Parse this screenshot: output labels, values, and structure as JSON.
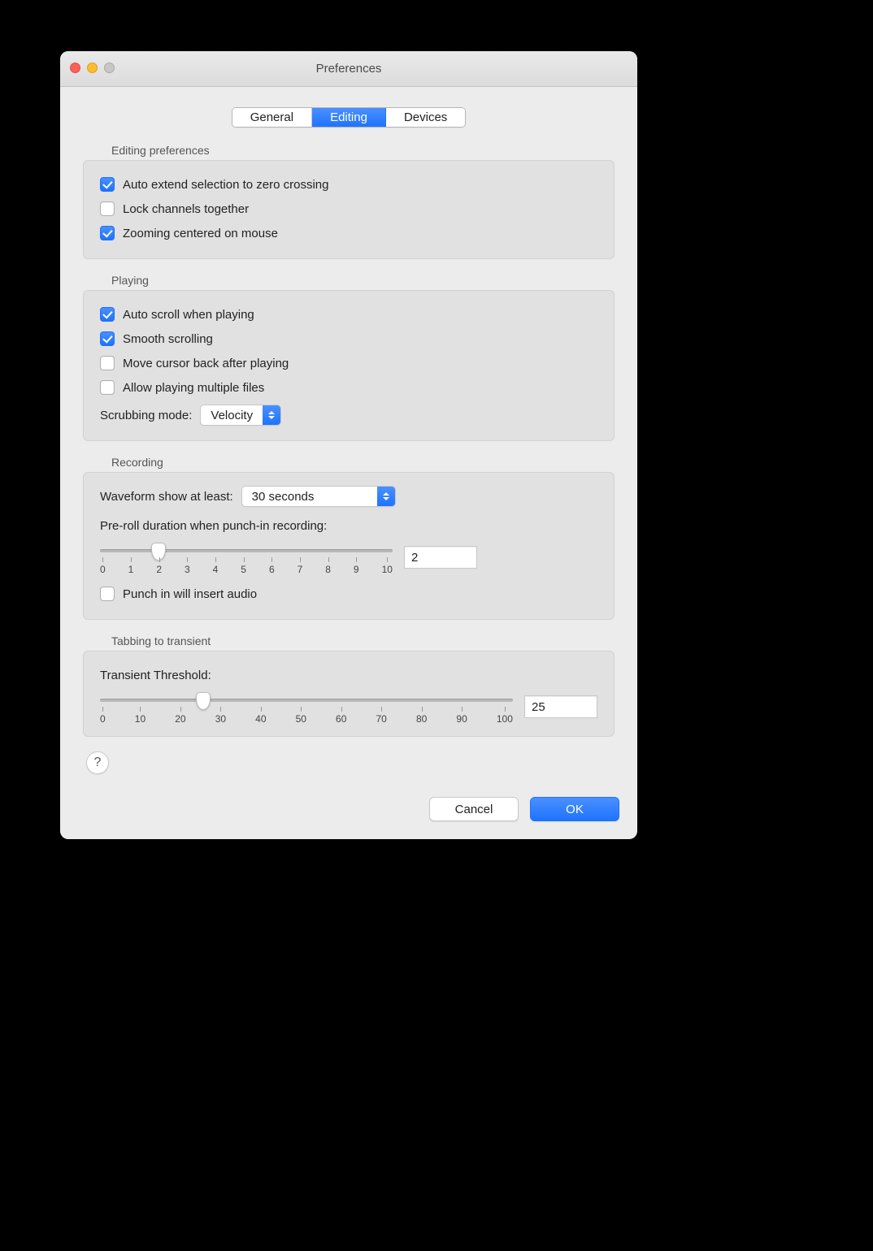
{
  "window": {
    "title": "Preferences"
  },
  "tabs": {
    "general": "General",
    "editing": "Editing",
    "devices": "Devices",
    "active": "editing"
  },
  "sections": {
    "editing": {
      "title": "Editing preferences",
      "autoExtend": {
        "label": "Auto extend selection to zero crossing",
        "checked": true
      },
      "lockChannels": {
        "label": "Lock channels together",
        "checked": false
      },
      "zoomCentered": {
        "label": "Zooming centered on mouse",
        "checked": true
      }
    },
    "playing": {
      "title": "Playing",
      "autoScroll": {
        "label": "Auto scroll when playing",
        "checked": true
      },
      "smoothScroll": {
        "label": "Smooth scrolling",
        "checked": true
      },
      "moveCursorBack": {
        "label": "Move cursor back after playing",
        "checked": false
      },
      "allowMultiple": {
        "label": "Allow playing multiple files",
        "checked": false
      },
      "scrubbingLabel": "Scrubbing mode:",
      "scrubbingValue": "Velocity"
    },
    "recording": {
      "title": "Recording",
      "waveformLabel": "Waveform show at least:",
      "waveformValue": "30 seconds",
      "prerollLabel": "Pre-roll duration when punch-in recording:",
      "prerollValue": "2",
      "prerollMin": 0,
      "prerollMax": 10,
      "prerollTicks": [
        "0",
        "1",
        "2",
        "3",
        "4",
        "5",
        "6",
        "7",
        "8",
        "9",
        "10"
      ],
      "punchInInsert": {
        "label": "Punch in will insert audio",
        "checked": false
      }
    },
    "tabbing": {
      "title": "Tabbing to transient",
      "thresholdLabel": "Transient Threshold:",
      "thresholdValue": "25",
      "thresholdMin": 0,
      "thresholdMax": 100,
      "thresholdTicks": [
        "0",
        "10",
        "20",
        "30",
        "40",
        "50",
        "60",
        "70",
        "80",
        "90",
        "100"
      ]
    }
  },
  "help": "?",
  "buttons": {
    "cancel": "Cancel",
    "ok": "OK"
  }
}
